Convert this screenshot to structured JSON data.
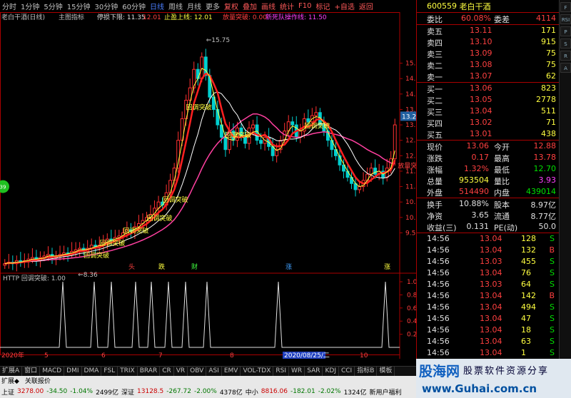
{
  "toolbar": {
    "items": [
      "分时",
      "1分钟",
      "5分钟",
      "15分钟",
      "30分钟",
      "60分钟",
      "日线",
      "周线",
      "月线",
      "更多",
      "复权",
      "叠加",
      "画线",
      "统计",
      "F10",
      "标记",
      "+自选",
      "返回"
    ],
    "selected": "日线"
  },
  "chart_title": "老白干酒(日线)",
  "main_indicator": "主图指标",
  "stop_line_label": "停损下限: 11.35",
  "val_1201": "12.01",
  "stopwin_label": "止盈上线: 12.01",
  "vol_label": "放量突破: 0.00",
  "queue_label": "新死队操作线: 11.50",
  "peak_label": "15.75",
  "low_label": "8.36",
  "signal_text": "回调突破",
  "signal_text2": "放量突破",
  "event_markers": [
    "糖",
    "跌",
    "财",
    "涨"
  ],
  "sub_title": "HTTP  回调突破: 1.00",
  "x_dates": [
    "2020年",
    "5",
    "6",
    "7",
    "8",
    "2020/08/25/二",
    "10"
  ],
  "current_price_tag": "13.27",
  "panel": {
    "code": "600559",
    "name": "老白干酒",
    "wb_label": "委比",
    "wb": "60.08%",
    "wc_label": "委差",
    "wc": "4114",
    "asks": [
      [
        "卖五",
        "13.11",
        "171"
      ],
      [
        "卖四",
        "13.10",
        "915"
      ],
      [
        "卖三",
        "13.09",
        "75"
      ],
      [
        "卖二",
        "13.08",
        "75"
      ],
      [
        "卖一",
        "13.07",
        "62"
      ]
    ],
    "bids": [
      [
        "买一",
        "13.06",
        "823"
      ],
      [
        "买二",
        "13.05",
        "2778"
      ],
      [
        "买三",
        "13.04",
        "511"
      ],
      [
        "买四",
        "13.02",
        "71"
      ],
      [
        "买五",
        "13.01",
        "438"
      ]
    ],
    "stats": [
      [
        "现价",
        "13.06",
        "今开",
        "12.88"
      ],
      [
        "涨跌",
        "0.17",
        "最高",
        "13.78"
      ],
      [
        "涨幅",
        "1.32%",
        "最低",
        "12.70"
      ],
      [
        "总量",
        "953504",
        "量比",
        "3.93"
      ],
      [
        "外盘",
        "514490",
        "内盘",
        "439014"
      ]
    ],
    "stats2": [
      [
        "换手",
        "10.88%",
        "股本",
        "8.97亿"
      ],
      [
        "净资",
        "3.65",
        "流通",
        "8.77亿"
      ],
      [
        "收益(三)",
        "0.131",
        "PE(动)",
        "50.0"
      ]
    ],
    "ticks": [
      [
        "14:56",
        "13.04",
        "128",
        "S"
      ],
      [
        "14:56",
        "13.04",
        "132",
        "B"
      ],
      [
        "14:56",
        "13.03",
        "455",
        "S"
      ],
      [
        "14:56",
        "13.04",
        "76",
        "S"
      ],
      [
        "14:56",
        "13.03",
        "64",
        "S"
      ],
      [
        "14:56",
        "13.04",
        "142",
        "B"
      ],
      [
        "14:56",
        "13.04",
        "494",
        "S"
      ],
      [
        "14:56",
        "13.04",
        "47",
        "S"
      ],
      [
        "14:56",
        "13.04",
        "18",
        "S"
      ],
      [
        "14:56",
        "13.04",
        "63",
        "S"
      ],
      [
        "14:56",
        "13.04",
        "1",
        "S"
      ],
      [
        "14:56",
        "13.04",
        "19",
        "S"
      ]
    ]
  },
  "tabs": [
    "扩展A",
    "窗口",
    "MACD",
    "DMI",
    "DMA",
    "FSL",
    "TRIX",
    "BRAR",
    "CR",
    "VR",
    "OBV",
    "ASI",
    "EMV",
    "VOL-TDX",
    "RSI",
    "WR",
    "SAR",
    "KDJ",
    "CCI",
    "指标B",
    "模板"
  ],
  "tabs2": [
    "扩展◆",
    "关联报价"
  ],
  "status": {
    "sh_label": "上证",
    "sh": "3278.00",
    "sh_chg": "-34.50",
    "sh_pct": "-1.04%",
    "sh_amt": "2499亿",
    "sz_label": "深证",
    "sz": "13128.5",
    "sz_chg": "-267.72",
    "sz_pct": "-2.00%",
    "sz_amt": "4378亿",
    "zx_label": "中小",
    "zx": "8816.06",
    "zx_chg": "-182.01",
    "zx_pct": "-2.02%",
    "zx_amt": "1324亿",
    "news": "新用户福利"
  },
  "logo": {
    "a": "股海网",
    "b": "股票软件资源分享",
    "c": "www.Guhai.com.cn"
  },
  "icons": [
    "F",
    "RSI",
    "P",
    "S",
    "R",
    "A"
  ],
  "circle_label": "39",
  "chart_data": {
    "type": "candlestick",
    "y_ticks": [
      9.5,
      10.0,
      10.5,
      11.0,
      11.5,
      12.0,
      12.5,
      13.0,
      13.5,
      14.0,
      14.5,
      15.0
    ],
    "y_range": [
      8.1,
      16.1
    ],
    "sub_ticks": [
      0.2,
      0.4,
      0.6,
      0.8,
      1.0
    ],
    "close": [
      8.5,
      8.55,
      8.5,
      8.6,
      8.55,
      8.6,
      8.65,
      8.7,
      8.6,
      8.7,
      8.75,
      8.8,
      8.7,
      8.75,
      8.8,
      8.85,
      8.8,
      8.9,
      8.95,
      9.0,
      8.9,
      9.0,
      9.1,
      9.05,
      9.1,
      9.2,
      9.3,
      9.25,
      9.35,
      9.4,
      9.5,
      9.6,
      9.55,
      9.7,
      9.8,
      9.9,
      10.0,
      10.1,
      10.3,
      10.5,
      10.4,
      10.8,
      11.2,
      11.6,
      12.5,
      13.2,
      13.8,
      14.2,
      14.8,
      14.5,
      15.2,
      14.6,
      13.9,
      13.5,
      13.0,
      12.6,
      12.2,
      12.8,
      12.5,
      12.9,
      12.6,
      12.4,
      12.9,
      13.0,
      12.5,
      12.4,
      12.6,
      12.3,
      12.0,
      12.2,
      12.5,
      12.8,
      13.1,
      13.0,
      12.6,
      12.8,
      13.2,
      13.1,
      13.3,
      13.4,
      13.0,
      12.8,
      12.5,
      12.2,
      12.0,
      11.7,
      11.5,
      11.3,
      11.1,
      10.9,
      11.0,
      11.2,
      11.4,
      11.6,
      11.4,
      11.5,
      11.3,
      11.6,
      11.9,
      13.0
    ],
    "signals": [
      32,
      42,
      46,
      50,
      54,
      60,
      66,
      84,
      96,
      170,
      220,
      254
    ]
  }
}
